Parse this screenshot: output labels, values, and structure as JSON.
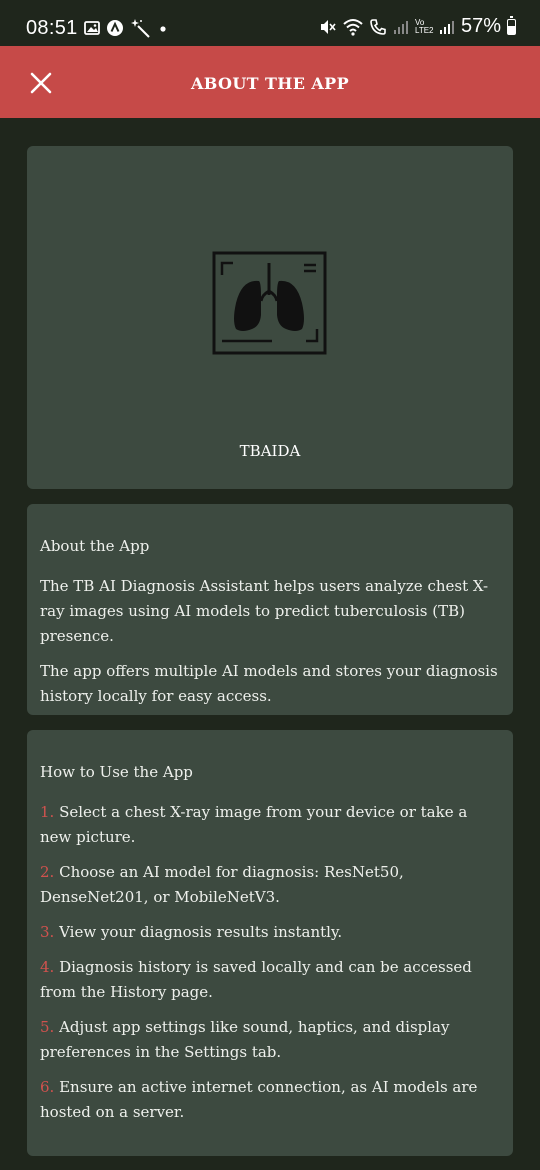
{
  "status_bar": {
    "time": "08:51",
    "battery": "57%",
    "network_label": "Vo LTE2",
    "icons": [
      "gallery-icon",
      "assistant-icon",
      "magic-wand-icon",
      "dot-icon",
      "mute-icon",
      "wifi-icon",
      "call-icon",
      "signal-icon",
      "battery-icon"
    ]
  },
  "header": {
    "title": "ABOUT THE APP",
    "close_icon": "close-icon",
    "background": "#c64a48"
  },
  "hero": {
    "logo_icon": "lungs-xray-icon",
    "app_name": "TBAIDA"
  },
  "about": {
    "title": "About the App",
    "paragraphs": [
      "The TB AI Diagnosis Assistant helps users analyze chest X-ray images using AI models to predict tuberculosis (TB) presence.",
      "The app offers multiple AI models and stores your diagnosis history locally for easy access."
    ]
  },
  "how_to": {
    "title": "How to Use the App",
    "steps": [
      {
        "num": "1.",
        "text": "Select a chest X-ray image from your device or take a new picture."
      },
      {
        "num": "2.",
        "text": "Choose an AI model for diagnosis: ResNet50, DenseNet201, or MobileNetV3."
      },
      {
        "num": "3.",
        "text": "View your diagnosis results instantly."
      },
      {
        "num": "4.",
        "text": "Diagnosis history is saved locally and can be accessed from the History page."
      },
      {
        "num": "5.",
        "text": "Adjust app settings like sound, haptics, and display preferences in the Settings tab."
      },
      {
        "num": "6.",
        "text": "Ensure an active internet connection, as AI models are hosted on a server."
      }
    ]
  },
  "colors": {
    "background": "#1f261c",
    "card": "#3d4a40",
    "accent": "#d0524e"
  }
}
